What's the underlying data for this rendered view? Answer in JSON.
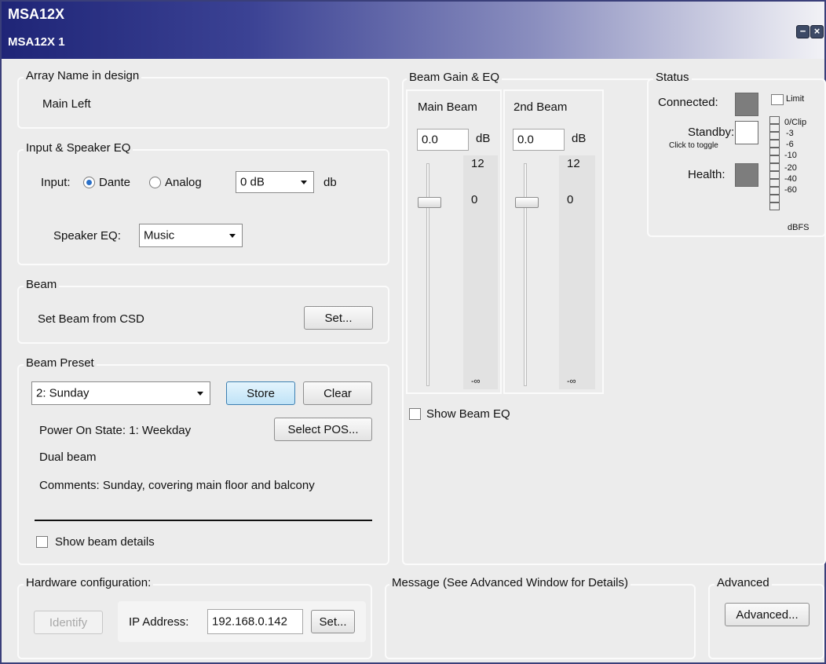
{
  "window": {
    "title": "MSA12X",
    "subtitle": "MSA12X 1",
    "minimize_icon": "−",
    "close_icon": "×"
  },
  "array_name": {
    "title": "Array Name in design",
    "value": "Main Left"
  },
  "input_eq": {
    "title": "Input & Speaker EQ",
    "input_label": "Input:",
    "options": [
      "Dante",
      "Analog"
    ],
    "selected": "Dante",
    "gain_value": "0 dB",
    "gain_unit": "db",
    "speaker_eq_label": "Speaker EQ:",
    "speaker_eq_value": "Music"
  },
  "beam": {
    "title": "Beam",
    "label": "Set Beam from CSD",
    "set_button": "Set..."
  },
  "beam_preset": {
    "title": "Beam Preset",
    "preset_value": "2: Sunday",
    "store_button": "Store",
    "clear_button": "Clear",
    "power_on_label": "Power On State:  1: Weekday",
    "select_pos_button": "Select POS...",
    "dual_beam": "Dual beam",
    "comments": "Comments:  Sunday, covering main floor and balcony",
    "show_details_label": "Show beam details"
  },
  "beam_gain": {
    "title": "Beam Gain & EQ",
    "main_label": "Main Beam",
    "second_label": "2nd Beam",
    "main_value": "0.0",
    "second_value": "0.0",
    "unit": "dB",
    "tick_top": "12",
    "tick_zero": "0",
    "tick_bottom": "-∞",
    "show_eq_label": "Show Beam EQ"
  },
  "status": {
    "title": "Status",
    "connected_label": "Connected:",
    "standby_label": "Standby:",
    "standby_hint": "Click to toggle",
    "health_label": "Health:",
    "limit_label": "Limit",
    "meter_labels": [
      "0/Clip",
      "-3",
      "-6",
      "-10",
      "-20",
      "-40",
      "-60"
    ],
    "meter_unit": "dBFS",
    "connected_color": "#7d7d7d",
    "health_color": "#7d7d7d"
  },
  "hardware": {
    "title": "Hardware configuration:",
    "identify_button": "Identify",
    "ip_label": "IP Address:",
    "ip_value": "192.168.0.142",
    "set_button": "Set..."
  },
  "message": {
    "title": "Message (See Advanced Window for Details)"
  },
  "advanced": {
    "title": "Advanced",
    "button": "Advanced..."
  }
}
